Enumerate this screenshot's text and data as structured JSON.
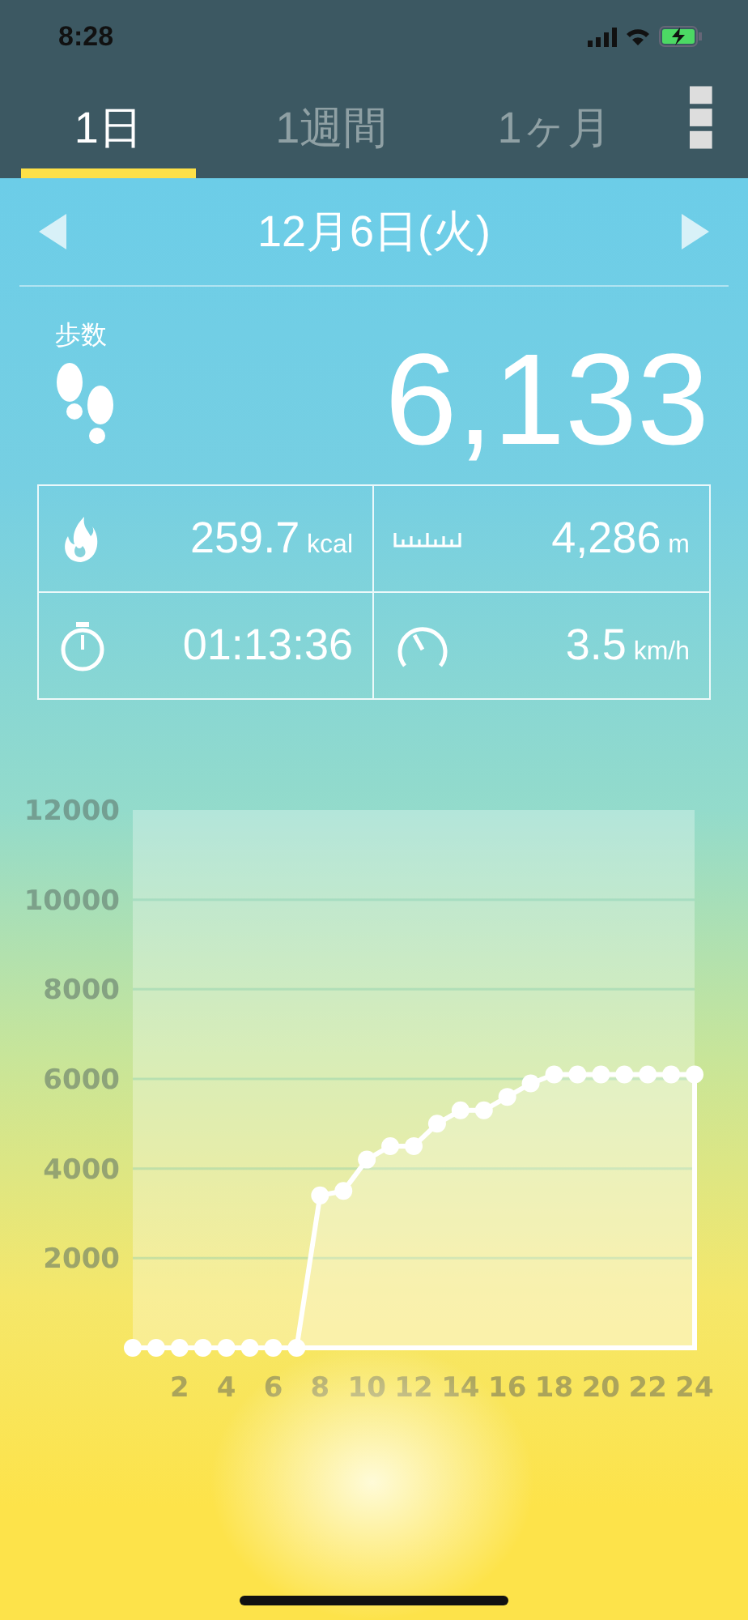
{
  "status_bar": {
    "time": "8:28"
  },
  "tabs": [
    {
      "label": "1日",
      "selected": true
    },
    {
      "label": "1週間",
      "selected": false
    },
    {
      "label": "1ヶ月",
      "selected": false
    }
  ],
  "date": "12月6日(火)",
  "steps": {
    "label": "歩数",
    "value": "6,133"
  },
  "metrics": [
    {
      "kind": "calories",
      "value": "259.7",
      "unit": "kcal"
    },
    {
      "kind": "distance",
      "value": "4,286",
      "unit": "m"
    },
    {
      "kind": "time",
      "value": "01:13:36"
    },
    {
      "kind": "speed",
      "value": "3.5",
      "unit": "km/h"
    }
  ],
  "chart": {
    "chart_data": {
      "type": "area",
      "x": [
        0,
        1,
        2,
        3,
        4,
        5,
        6,
        7,
        8,
        9,
        10,
        11,
        12,
        13,
        14,
        15,
        16,
        17,
        18,
        19,
        20,
        21,
        22,
        23,
        24
      ],
      "series": [
        {
          "color": "#ffffff",
          "values": [
            0,
            0,
            0,
            0,
            0,
            0,
            0,
            0,
            3400,
            3500,
            4200,
            4500,
            4500,
            5000,
            5300,
            5300,
            5600,
            5900,
            6100,
            6100,
            6100,
            6100,
            6100,
            6100,
            6100
          ]
        }
      ],
      "grid": true,
      "xlim": [
        0,
        24
      ],
      "ylim": [
        0,
        12000
      ],
      "xticks": [
        2,
        4,
        6,
        8,
        10,
        12,
        14,
        16,
        18,
        20,
        22,
        24
      ],
      "yticks": [
        2000,
        4000,
        6000,
        8000,
        10000,
        12000
      ]
    }
  }
}
